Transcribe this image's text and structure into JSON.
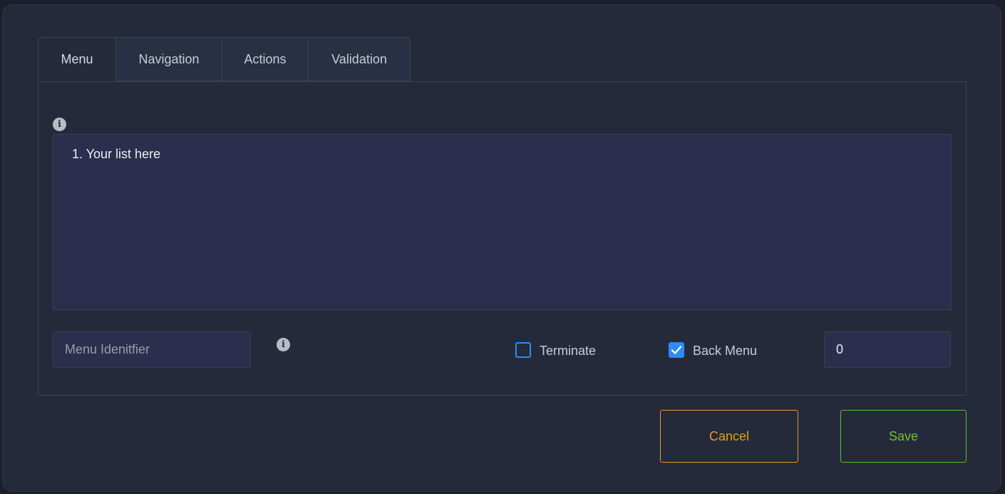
{
  "tabs": [
    {
      "label": "Menu",
      "active": true
    },
    {
      "label": "Navigation",
      "active": false
    },
    {
      "label": "Actions",
      "active": false
    },
    {
      "label": "Validation",
      "active": false
    }
  ],
  "menu": {
    "text_value": "1. Your list here",
    "identifier_placeholder": "Menu Idenitfier",
    "identifier_value": "",
    "terminate_label": "Terminate",
    "terminate_checked": false,
    "back_menu_label": "Back Menu",
    "back_menu_checked": true,
    "back_menu_value": "0"
  },
  "icons": {
    "info": "info-icon",
    "info_glyph": "i",
    "check": "checkmark-icon"
  },
  "buttons": {
    "cancel_label": "Cancel",
    "save_label": "Save"
  },
  "colors": {
    "cancel": "#e89c1f",
    "save": "#6fc22b",
    "checkbox": "#2f8bf0",
    "background": "#252a3b"
  }
}
